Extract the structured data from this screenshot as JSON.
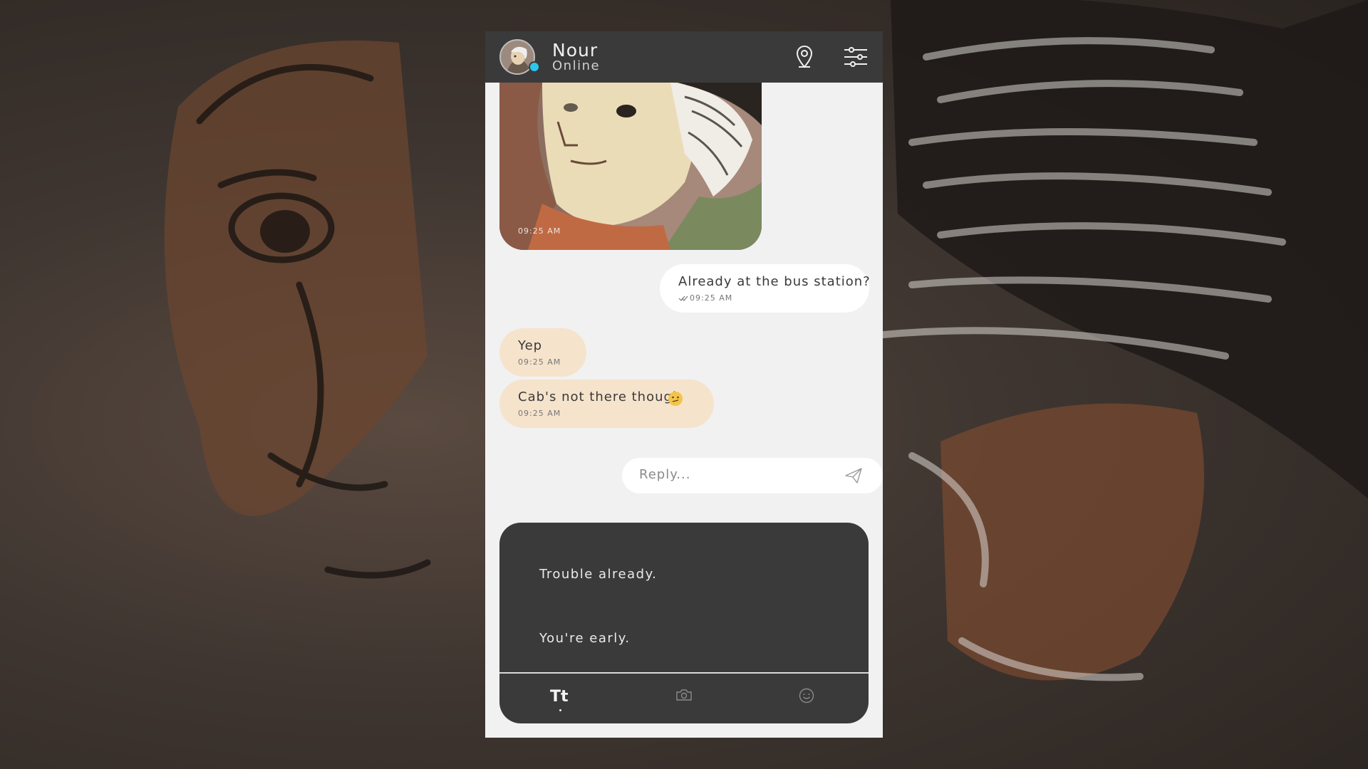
{
  "contact": {
    "name": "Nour",
    "status": "Online"
  },
  "messages": [
    {
      "type": "image",
      "time": "09:25 AM"
    },
    {
      "type": "outgoing",
      "text": "Already at the bus station?",
      "time": "09:25 AM",
      "read_receipt": "double-check-icon"
    },
    {
      "type": "incoming",
      "text": "Yep",
      "time": "09:25 AM"
    },
    {
      "type": "incoming",
      "text": "Cab's not there though",
      "emoji": "confused-face-icon",
      "time": "09:25 AM"
    }
  ],
  "reply": {
    "placeholder": "Reply..."
  },
  "choices": [
    "Trouble already.",
    "You're early."
  ],
  "tabs": {
    "text_label": "Tt",
    "camera": "camera-icon",
    "emoji": "smiley-icon"
  },
  "colors": {
    "header": "#3a3a3a",
    "chat_bg": "#f1f1f1",
    "incoming_bubble": "#f5e3cc",
    "outgoing_bubble": "#ffffff",
    "online_dot": "#2cc7ec"
  }
}
